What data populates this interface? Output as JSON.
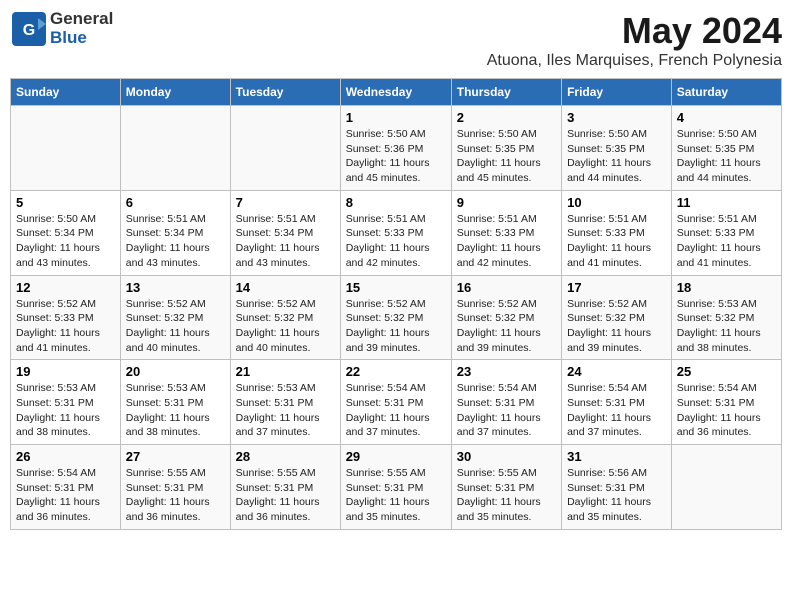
{
  "logo": {
    "general": "General",
    "blue": "Blue"
  },
  "title": "May 2024",
  "subtitle": "Atuona, Iles Marquises, French Polynesia",
  "weekdays": [
    "Sunday",
    "Monday",
    "Tuesday",
    "Wednesday",
    "Thursday",
    "Friday",
    "Saturday"
  ],
  "weeks": [
    [
      {
        "day": "",
        "sunrise": "",
        "sunset": "",
        "daylight": ""
      },
      {
        "day": "",
        "sunrise": "",
        "sunset": "",
        "daylight": ""
      },
      {
        "day": "",
        "sunrise": "",
        "sunset": "",
        "daylight": ""
      },
      {
        "day": "1",
        "sunrise": "Sunrise: 5:50 AM",
        "sunset": "Sunset: 5:36 PM",
        "daylight": "Daylight: 11 hours and 45 minutes."
      },
      {
        "day": "2",
        "sunrise": "Sunrise: 5:50 AM",
        "sunset": "Sunset: 5:35 PM",
        "daylight": "Daylight: 11 hours and 45 minutes."
      },
      {
        "day": "3",
        "sunrise": "Sunrise: 5:50 AM",
        "sunset": "Sunset: 5:35 PM",
        "daylight": "Daylight: 11 hours and 44 minutes."
      },
      {
        "day": "4",
        "sunrise": "Sunrise: 5:50 AM",
        "sunset": "Sunset: 5:35 PM",
        "daylight": "Daylight: 11 hours and 44 minutes."
      }
    ],
    [
      {
        "day": "5",
        "sunrise": "Sunrise: 5:50 AM",
        "sunset": "Sunset: 5:34 PM",
        "daylight": "Daylight: 11 hours and 43 minutes."
      },
      {
        "day": "6",
        "sunrise": "Sunrise: 5:51 AM",
        "sunset": "Sunset: 5:34 PM",
        "daylight": "Daylight: 11 hours and 43 minutes."
      },
      {
        "day": "7",
        "sunrise": "Sunrise: 5:51 AM",
        "sunset": "Sunset: 5:34 PM",
        "daylight": "Daylight: 11 hours and 43 minutes."
      },
      {
        "day": "8",
        "sunrise": "Sunrise: 5:51 AM",
        "sunset": "Sunset: 5:33 PM",
        "daylight": "Daylight: 11 hours and 42 minutes."
      },
      {
        "day": "9",
        "sunrise": "Sunrise: 5:51 AM",
        "sunset": "Sunset: 5:33 PM",
        "daylight": "Daylight: 11 hours and 42 minutes."
      },
      {
        "day": "10",
        "sunrise": "Sunrise: 5:51 AM",
        "sunset": "Sunset: 5:33 PM",
        "daylight": "Daylight: 11 hours and 41 minutes."
      },
      {
        "day": "11",
        "sunrise": "Sunrise: 5:51 AM",
        "sunset": "Sunset: 5:33 PM",
        "daylight": "Daylight: 11 hours and 41 minutes."
      }
    ],
    [
      {
        "day": "12",
        "sunrise": "Sunrise: 5:52 AM",
        "sunset": "Sunset: 5:33 PM",
        "daylight": "Daylight: 11 hours and 41 minutes."
      },
      {
        "day": "13",
        "sunrise": "Sunrise: 5:52 AM",
        "sunset": "Sunset: 5:32 PM",
        "daylight": "Daylight: 11 hours and 40 minutes."
      },
      {
        "day": "14",
        "sunrise": "Sunrise: 5:52 AM",
        "sunset": "Sunset: 5:32 PM",
        "daylight": "Daylight: 11 hours and 40 minutes."
      },
      {
        "day": "15",
        "sunrise": "Sunrise: 5:52 AM",
        "sunset": "Sunset: 5:32 PM",
        "daylight": "Daylight: 11 hours and 39 minutes."
      },
      {
        "day": "16",
        "sunrise": "Sunrise: 5:52 AM",
        "sunset": "Sunset: 5:32 PM",
        "daylight": "Daylight: 11 hours and 39 minutes."
      },
      {
        "day": "17",
        "sunrise": "Sunrise: 5:52 AM",
        "sunset": "Sunset: 5:32 PM",
        "daylight": "Daylight: 11 hours and 39 minutes."
      },
      {
        "day": "18",
        "sunrise": "Sunrise: 5:53 AM",
        "sunset": "Sunset: 5:32 PM",
        "daylight": "Daylight: 11 hours and 38 minutes."
      }
    ],
    [
      {
        "day": "19",
        "sunrise": "Sunrise: 5:53 AM",
        "sunset": "Sunset: 5:31 PM",
        "daylight": "Daylight: 11 hours and 38 minutes."
      },
      {
        "day": "20",
        "sunrise": "Sunrise: 5:53 AM",
        "sunset": "Sunset: 5:31 PM",
        "daylight": "Daylight: 11 hours and 38 minutes."
      },
      {
        "day": "21",
        "sunrise": "Sunrise: 5:53 AM",
        "sunset": "Sunset: 5:31 PM",
        "daylight": "Daylight: 11 hours and 37 minutes."
      },
      {
        "day": "22",
        "sunrise": "Sunrise: 5:54 AM",
        "sunset": "Sunset: 5:31 PM",
        "daylight": "Daylight: 11 hours and 37 minutes."
      },
      {
        "day": "23",
        "sunrise": "Sunrise: 5:54 AM",
        "sunset": "Sunset: 5:31 PM",
        "daylight": "Daylight: 11 hours and 37 minutes."
      },
      {
        "day": "24",
        "sunrise": "Sunrise: 5:54 AM",
        "sunset": "Sunset: 5:31 PM",
        "daylight": "Daylight: 11 hours and 37 minutes."
      },
      {
        "day": "25",
        "sunrise": "Sunrise: 5:54 AM",
        "sunset": "Sunset: 5:31 PM",
        "daylight": "Daylight: 11 hours and 36 minutes."
      }
    ],
    [
      {
        "day": "26",
        "sunrise": "Sunrise: 5:54 AM",
        "sunset": "Sunset: 5:31 PM",
        "daylight": "Daylight: 11 hours and 36 minutes."
      },
      {
        "day": "27",
        "sunrise": "Sunrise: 5:55 AM",
        "sunset": "Sunset: 5:31 PM",
        "daylight": "Daylight: 11 hours and 36 minutes."
      },
      {
        "day": "28",
        "sunrise": "Sunrise: 5:55 AM",
        "sunset": "Sunset: 5:31 PM",
        "daylight": "Daylight: 11 hours and 36 minutes."
      },
      {
        "day": "29",
        "sunrise": "Sunrise: 5:55 AM",
        "sunset": "Sunset: 5:31 PM",
        "daylight": "Daylight: 11 hours and 35 minutes."
      },
      {
        "day": "30",
        "sunrise": "Sunrise: 5:55 AM",
        "sunset": "Sunset: 5:31 PM",
        "daylight": "Daylight: 11 hours and 35 minutes."
      },
      {
        "day": "31",
        "sunrise": "Sunrise: 5:56 AM",
        "sunset": "Sunset: 5:31 PM",
        "daylight": "Daylight: 11 hours and 35 minutes."
      },
      {
        "day": "",
        "sunrise": "",
        "sunset": "",
        "daylight": ""
      }
    ]
  ]
}
